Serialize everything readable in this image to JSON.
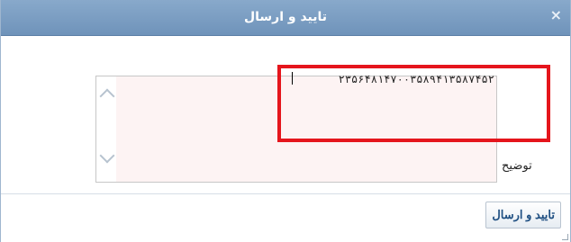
{
  "dialog": {
    "title": "تایید و ارسال",
    "close_glyph": "×"
  },
  "form": {
    "description_label": "توضیح",
    "description_value": "۲۳۵۶۴۸۱۴۷۰۰۳۵۸۹۴۱۳۵۸۷۴۵۲"
  },
  "footer": {
    "submit_label": "تایید و ارسال"
  },
  "icons": {
    "close": "close-icon",
    "scroll_up": "chevron-up-icon",
    "scroll_down": "chevron-down-icon",
    "resize": "resize-grip-icon"
  },
  "colors": {
    "titlebar": "#7a9cc1",
    "highlight": "#e5151c",
    "field_background": "#fdf3f3",
    "button_text": "#1f4f82"
  }
}
